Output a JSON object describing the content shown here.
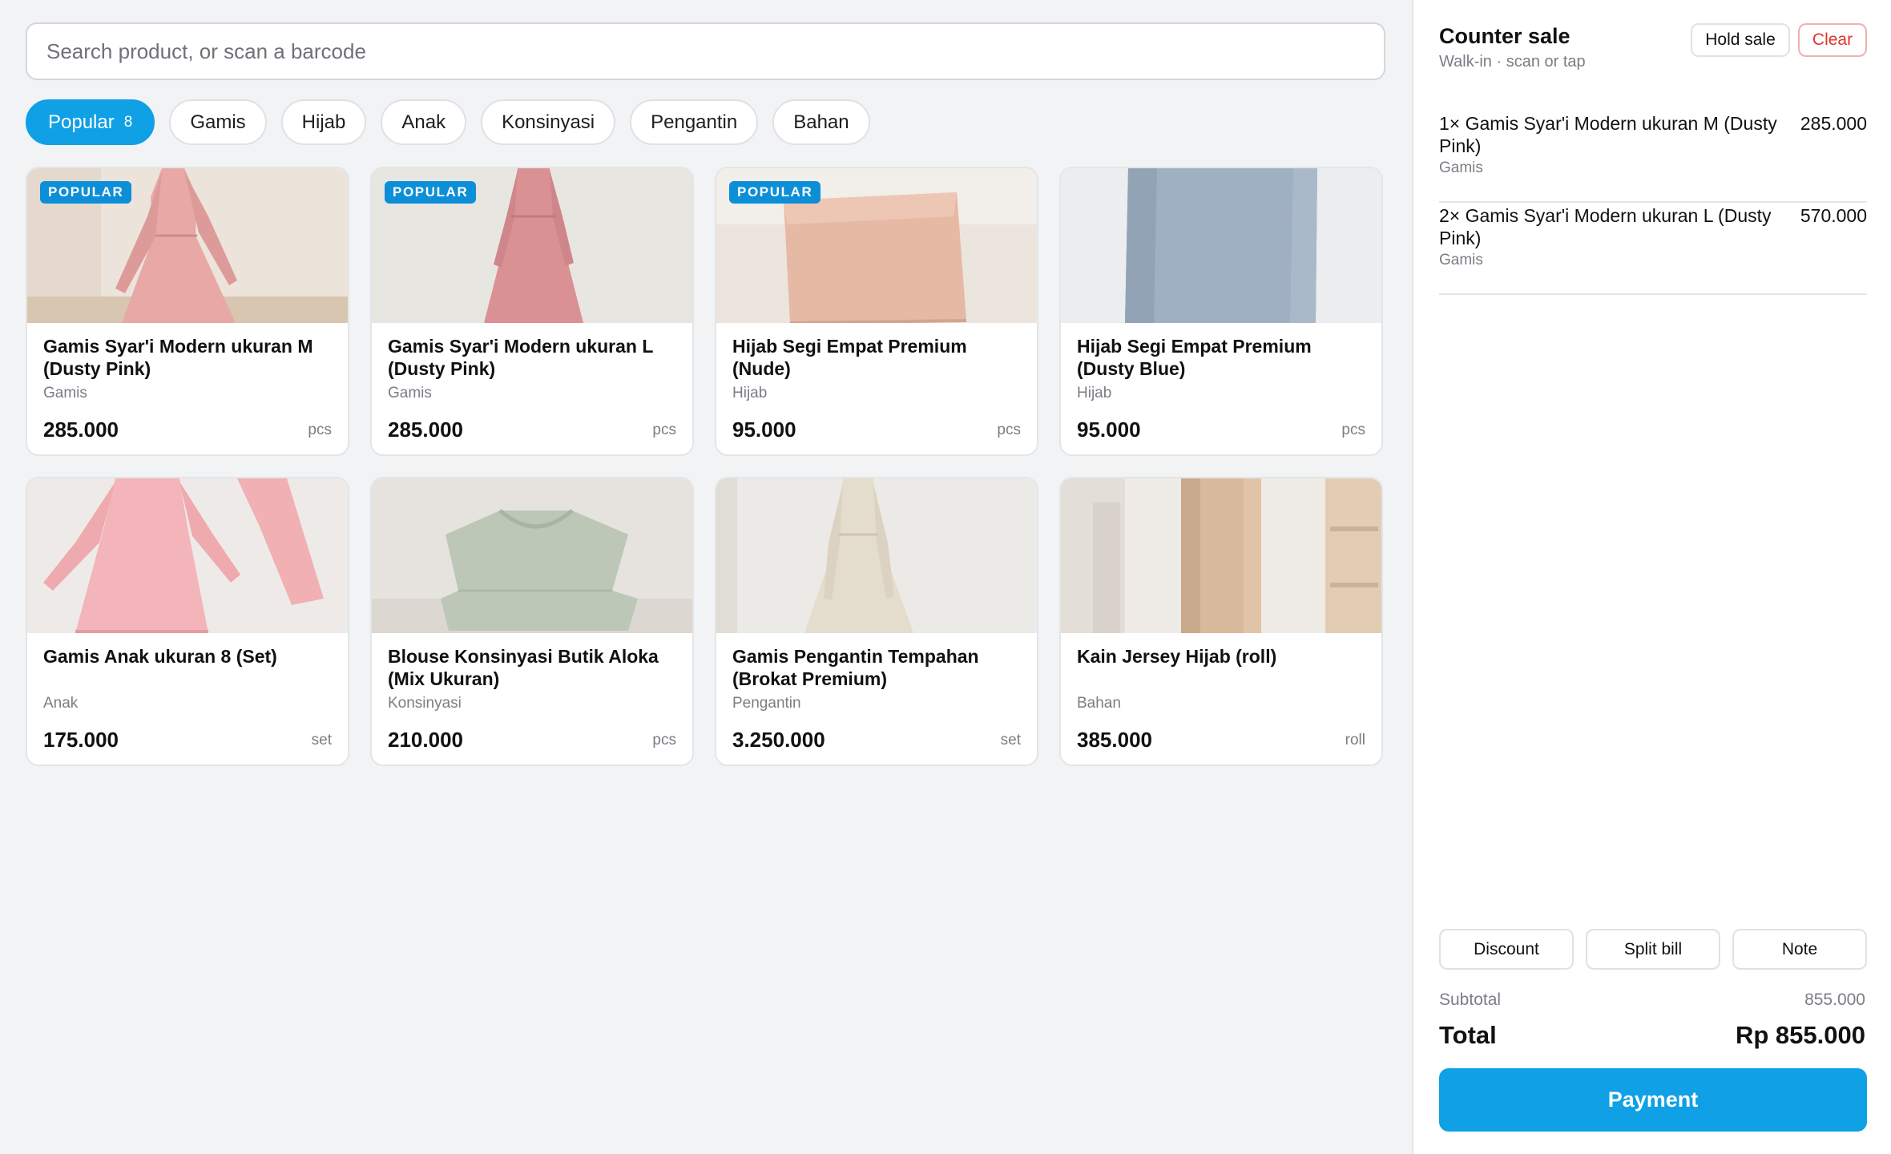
{
  "search": {
    "placeholder": "Search product, or scan a barcode"
  },
  "categories": [
    {
      "label": "Popular",
      "count": "8"
    },
    {
      "label": "Gamis"
    },
    {
      "label": "Hijab"
    },
    {
      "label": "Anak"
    },
    {
      "label": "Konsinyasi"
    },
    {
      "label": "Pengantin"
    },
    {
      "label": "Bahan"
    }
  ],
  "products": [
    {
      "badge": "POPULAR",
      "name": "Gamis Syar'i Modern ukuran M (Dusty Pink)",
      "category": "Gamis",
      "price": "285.000",
      "unit": "pcs"
    },
    {
      "badge": "POPULAR",
      "name": "Gamis Syar'i Modern ukuran L (Dusty Pink)",
      "category": "Gamis",
      "price": "285.000",
      "unit": "pcs"
    },
    {
      "badge": "POPULAR",
      "name": "Hijab Segi Empat Premium (Nude)",
      "category": "Hijab",
      "price": "95.000",
      "unit": "pcs"
    },
    {
      "name": "Hijab Segi Empat Premium (Dusty Blue)",
      "category": "Hijab",
      "price": "95.000",
      "unit": "pcs"
    },
    {
      "name": "Gamis Anak ukuran 8 (Set)",
      "category": "Anak",
      "price": "175.000",
      "unit": "set"
    },
    {
      "name": "Blouse Konsinyasi Butik Aloka (Mix Ukuran)",
      "category": "Konsinyasi",
      "price": "210.000",
      "unit": "pcs"
    },
    {
      "name": "Gamis Pengantin Tempahan (Brokat Premium)",
      "category": "Pengantin",
      "price": "3.250.000",
      "unit": "set"
    },
    {
      "name": "Kain Jersey Hijab (roll)",
      "category": "Bahan",
      "price": "385.000",
      "unit": "roll"
    }
  ],
  "cart": {
    "title": "Counter sale",
    "subtitle": "Walk-in · scan or tap",
    "hold_label": "Hold sale",
    "clear_label": "Clear",
    "lines": [
      {
        "name": "1× Gamis Syar'i Modern ukuran M (Dusty Pink)",
        "category": "Gamis",
        "amount": "285.000"
      },
      {
        "name": "2× Gamis Syar'i Modern ukuran L (Dusty Pink)",
        "category": "Gamis",
        "amount": "570.000"
      }
    ],
    "discount_label": "Discount",
    "split_label": "Split bill",
    "note_label": "Note",
    "subtotal_label": "Subtotal",
    "subtotal_value": "855.000",
    "total_label": "Total",
    "total_value": "Rp 855.000",
    "pay_label": "Payment"
  },
  "colors": {
    "accent": "#0fa0e6",
    "badge": "#0d8fd8",
    "danger": "#e0342c"
  }
}
